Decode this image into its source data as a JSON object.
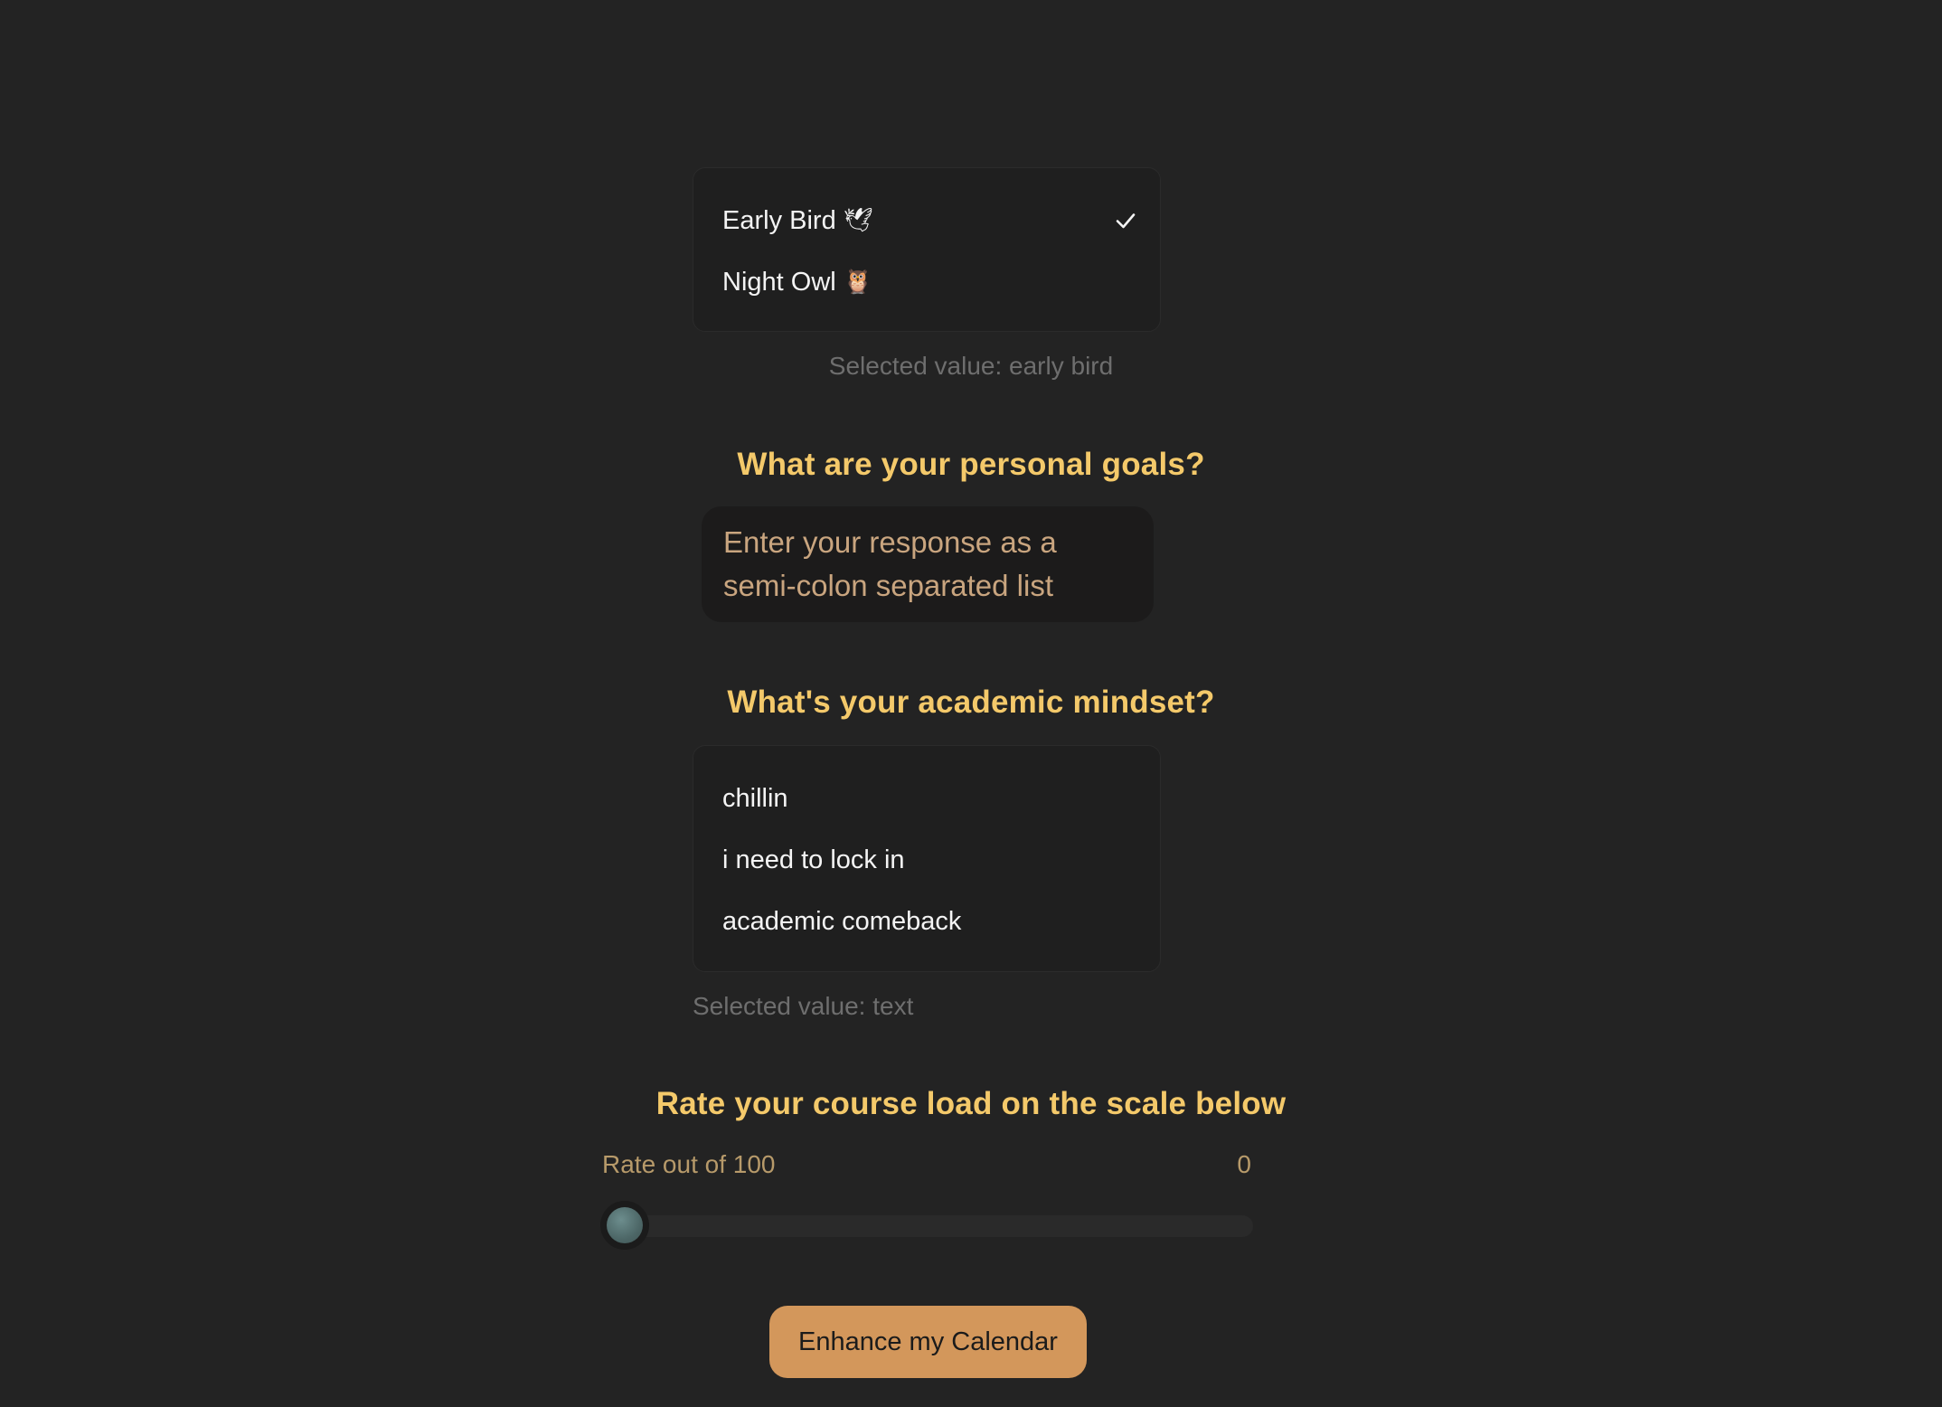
{
  "chronotype": {
    "options": [
      {
        "label": "Early Bird",
        "emoji": "🕊",
        "selected": true
      },
      {
        "label": "Night Owl",
        "emoji": "🦉",
        "selected": false
      }
    ],
    "selected_text": "Selected value: early bird"
  },
  "goals": {
    "heading": "What are your personal goals?",
    "placeholder": "Enter your response as a semi-colon separated list"
  },
  "mindset": {
    "heading": "What's your academic mindset?",
    "options": [
      {
        "label": "chillin"
      },
      {
        "label": "i need to lock in"
      },
      {
        "label": "academic comeback"
      }
    ],
    "selected_text": "Selected value: text"
  },
  "course_load": {
    "heading": "Rate your course load on the scale below",
    "label": "Rate out of 100",
    "value": "0",
    "min": 0,
    "max": 100
  },
  "cta": {
    "label": "Enhance my Calendar"
  },
  "colors": {
    "background": "#232323",
    "heading": "#f4c96a",
    "button": "#d3975b"
  }
}
